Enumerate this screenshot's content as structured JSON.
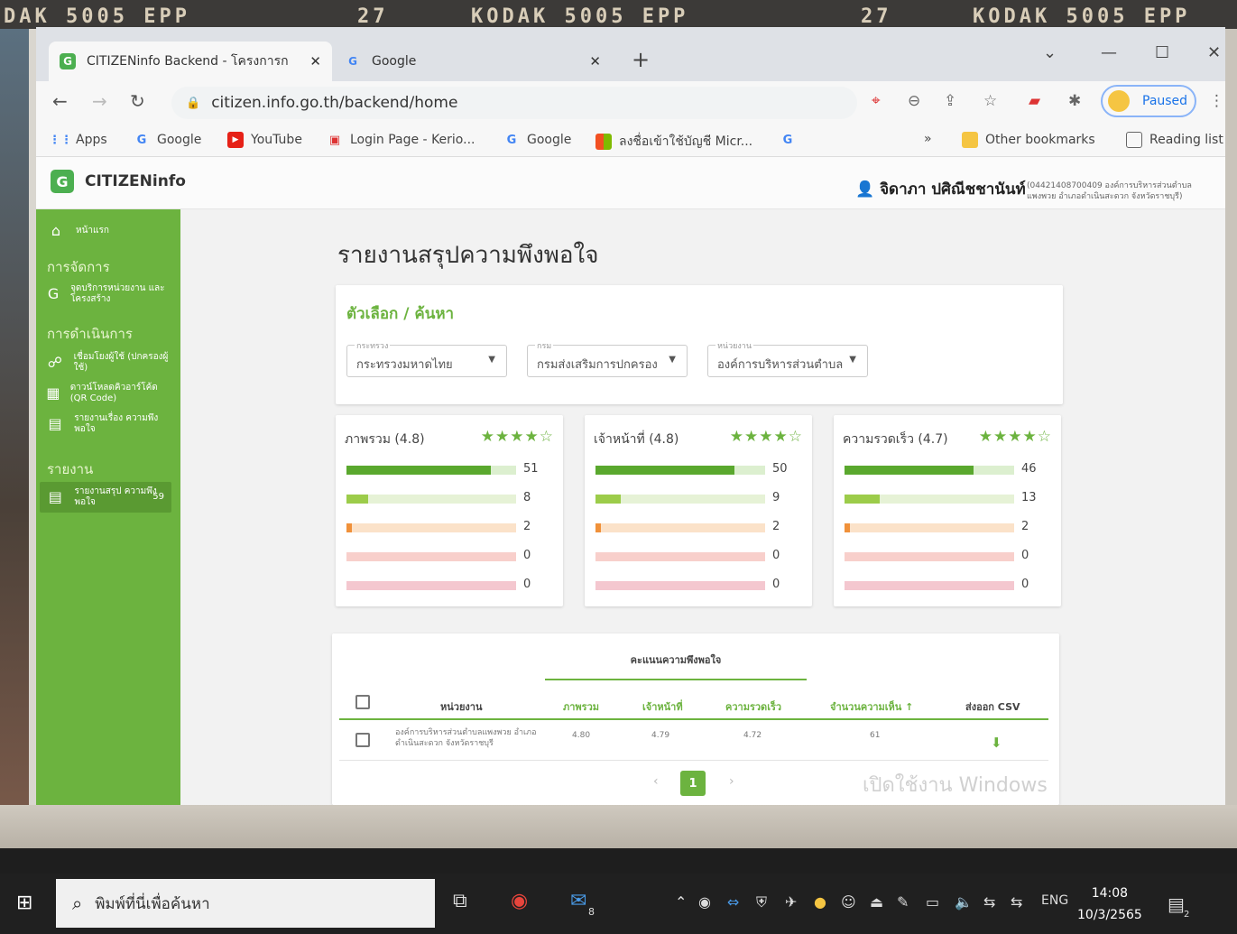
{
  "film": {
    "top_left": "DAK 5005 EPP",
    "frame_a": "27",
    "top_mid": "KODAK 5005 EPP",
    "frame_b": "27",
    "top_right": "KODAK 5005 EPP"
  },
  "browser": {
    "tabs": [
      {
        "label": "CITIZENinfo Backend - โครงการก",
        "favicon": "G",
        "active": true
      },
      {
        "label": "Google",
        "favicon": "G",
        "active": false
      }
    ],
    "url": "citizen.info.go.th/backend/home",
    "profile_label": "Paused",
    "bookmarks": [
      "Apps",
      "Google",
      "YouTube",
      "Login Page - Kerio...",
      "Google",
      "ลงชื่อเข้าใช้บัญชี Micr..."
    ],
    "other_bookmarks": "Other bookmarks",
    "reading_list": "Reading list",
    "more": "»"
  },
  "app": {
    "brand": "CITIZENinfo",
    "user_name": "จิดาภา ปศิณีชชานันท์",
    "user_org": "(04421408700409 องค์การบริหารส่วนตำบล แพงพวย อำเภอดำเนินสะดวก จังหวัดราชบุรี)",
    "sidebar": {
      "home": "หน้าแรก",
      "section_manage": "การจัดการ",
      "manage_item": "จุดบริการหน่วยงาน และโครงสร้าง",
      "section_ops": "การดำเนินการ",
      "ops_items": [
        "เชื่อมโยงผู้ใช้ (ปกครองผู้ใช้)",
        "ดาวน์โหลดคิวอาร์โค้ด (QR Code)",
        "รายงานเรื่อง ความพึงพอใจ"
      ],
      "section_report": "รายงาน",
      "report_item": "รายงานสรุป ความพึงพอใจ",
      "report_badge": "59"
    },
    "page_title": "รายงานสรุปความพึงพอใจ",
    "filter": {
      "title": "ตัวเลือก / ค้นหา",
      "selects": [
        {
          "label": "กระทรวง",
          "value": "กระทรวงมหาดไทย"
        },
        {
          "label": "กรม",
          "value": "กรมส่งเสริมการปกครอง"
        },
        {
          "label": "หน่วยงาน",
          "value": "องค์การบริหารส่วนตำบล"
        }
      ]
    },
    "stats": [
      {
        "title": "ภาพรวม (4.8)",
        "stars": 4,
        "counts": [
          51,
          8,
          2,
          0,
          0
        ],
        "fractions": [
          0.85,
          0.13,
          0.03,
          0,
          0
        ]
      },
      {
        "title": "เจ้าหน้าที่ (4.8)",
        "stars": 4,
        "counts": [
          50,
          9,
          2,
          0,
          0
        ],
        "fractions": [
          0.82,
          0.15,
          0.03,
          0,
          0
        ]
      },
      {
        "title": "ความรวดเร็ว (4.7)",
        "stars": 4,
        "counts": [
          46,
          13,
          2,
          0,
          0
        ],
        "fractions": [
          0.76,
          0.21,
          0.03,
          0,
          0
        ]
      }
    ],
    "bar_colors": [
      {
        "fill": "#5aa82e",
        "track": "#dcefcf"
      },
      {
        "fill": "#9ccc4a",
        "track": "#e6f2d6"
      },
      {
        "fill": "#f0913a",
        "track": "#fbe2c9"
      },
      {
        "fill": "#ef8f86",
        "track": "#f8cfcb"
      },
      {
        "fill": "#e88a98",
        "track": "#f4c7cf"
      }
    ],
    "table": {
      "group_header": "คะแนนความพึงพอใจ",
      "columns": [
        "หน่วยงาน",
        "ภาพรวม",
        "เจ้าหน้าที่",
        "ความรวดเร็ว",
        "จำนวนความเห็น ↑",
        "ส่งออก CSV"
      ],
      "rows": [
        {
          "unit": "องค์การบริหารส่วนตำบลแพงพวย อำเภอดำเนินสะดวก จังหวัดราชบุรี",
          "overall": "4.80",
          "staff": "4.79",
          "speed": "4.72",
          "comments": "61"
        }
      ],
      "page": "1",
      "prev": "‹",
      "next": "›"
    },
    "watermark": "เปิดใช้งาน Windows"
  },
  "taskbar": {
    "search_placeholder": "พิมพ์ที่นี่เพื่อค้นหา",
    "mail_badge": "8",
    "lang": "ENG",
    "time": "14:08",
    "date": "10/3/2565",
    "notif_badge": "2"
  },
  "colors": {
    "accent": "#6cb33f",
    "sidebar": "#6cb33f"
  }
}
